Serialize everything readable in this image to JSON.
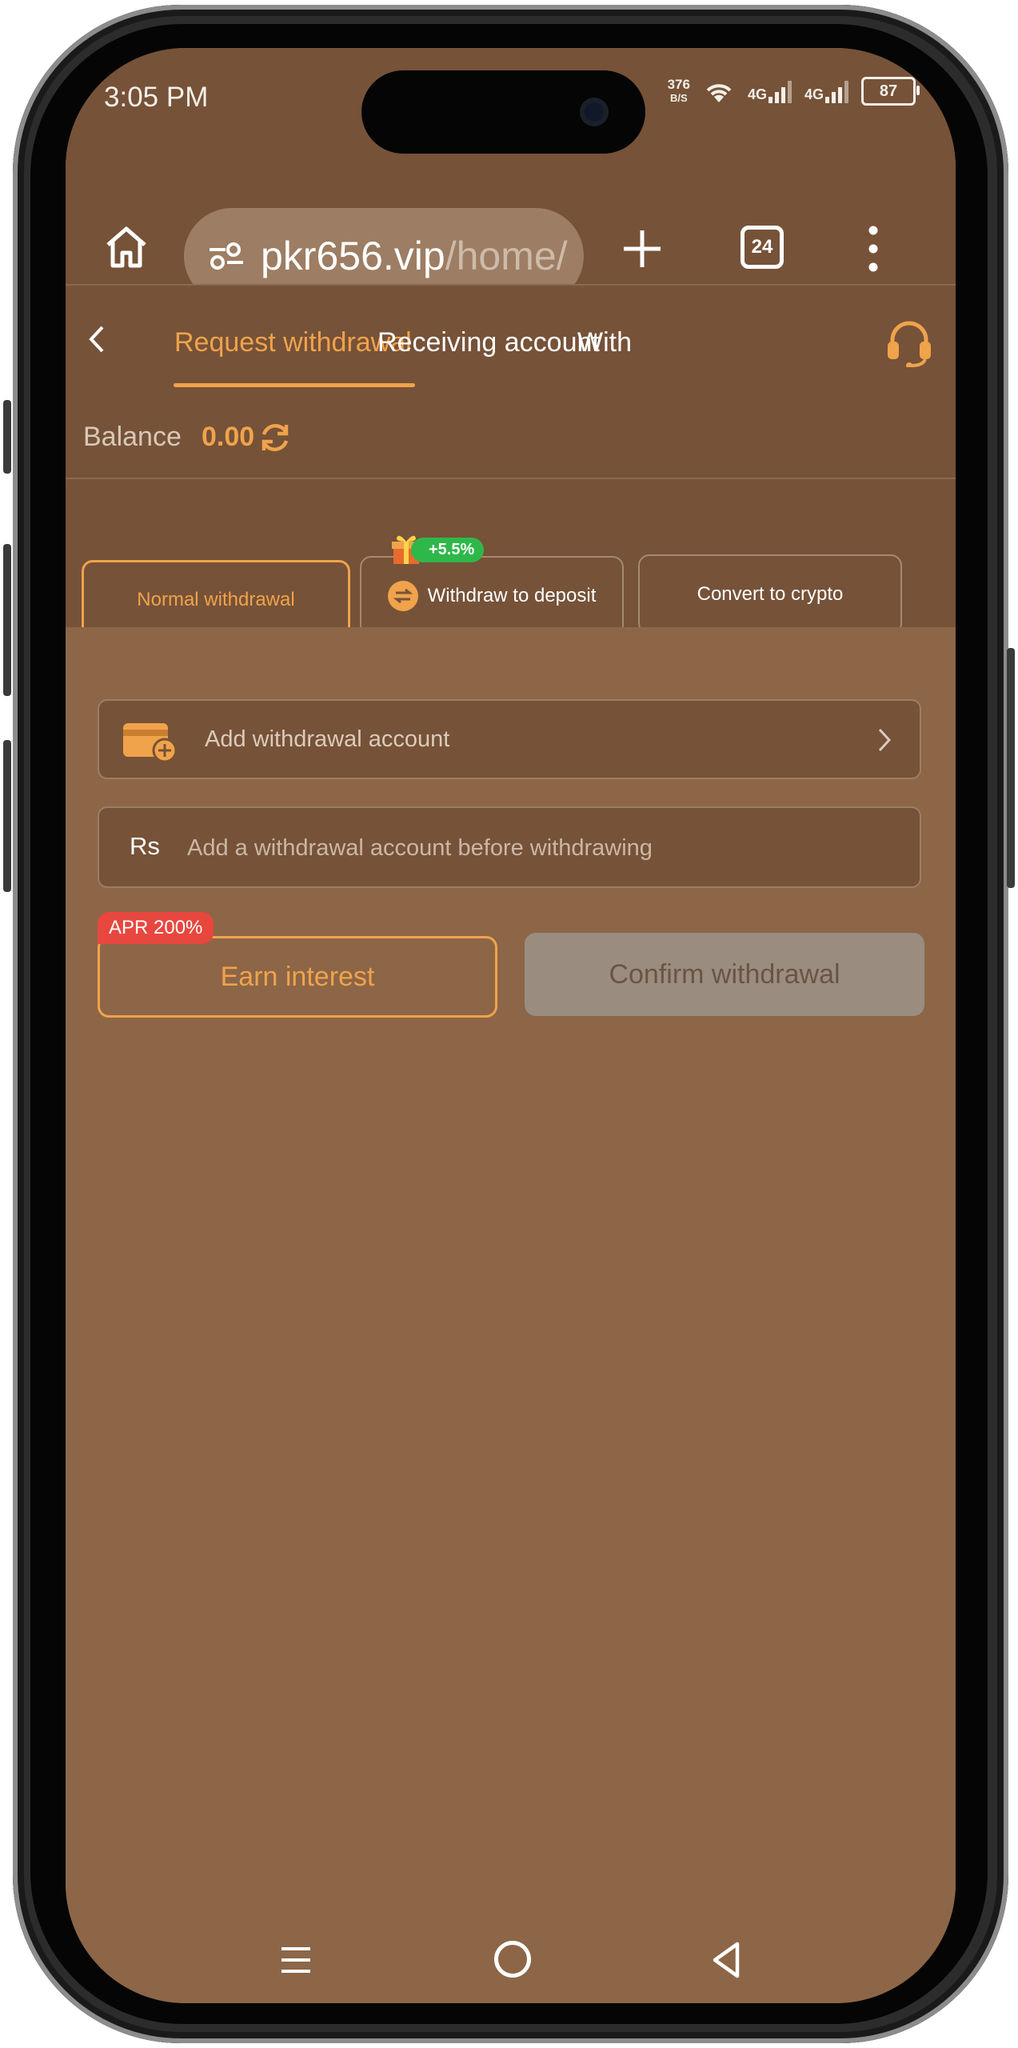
{
  "status_bar": {
    "time": "3:05 PM",
    "net_speed_value": "376",
    "net_speed_unit": "B/S",
    "signal1": "4G",
    "signal2": "4G",
    "battery": "87"
  },
  "browser": {
    "url_domain": "pkr656.vip",
    "url_path": "/home/",
    "tab_count": "24"
  },
  "tabs": [
    {
      "label": "Request withdrawal",
      "active": true
    },
    {
      "label": "Receiving account",
      "active": false
    },
    {
      "label": "With",
      "active": false
    }
  ],
  "balance": {
    "label": "Balance",
    "value": "0.00"
  },
  "methods": {
    "normal": "Normal withdrawal",
    "deposit": "Withdraw to deposit",
    "crypto": "Convert to crypto",
    "deposit_bonus": "+5.5%"
  },
  "account": {
    "add_label": "Add withdrawal account"
  },
  "amount": {
    "currency": "Rs",
    "placeholder": "Add a withdrawal account before withdrawing"
  },
  "actions": {
    "earn_label": "Earn interest",
    "apr_badge": "APR 200%",
    "confirm_label": "Confirm withdrawal"
  },
  "colors": {
    "accent": "#f0a34b",
    "header_bg": "#765238",
    "page_bg": "#8c6647",
    "bonus_green": "#2eb84a",
    "apr_red": "#e8473e"
  }
}
